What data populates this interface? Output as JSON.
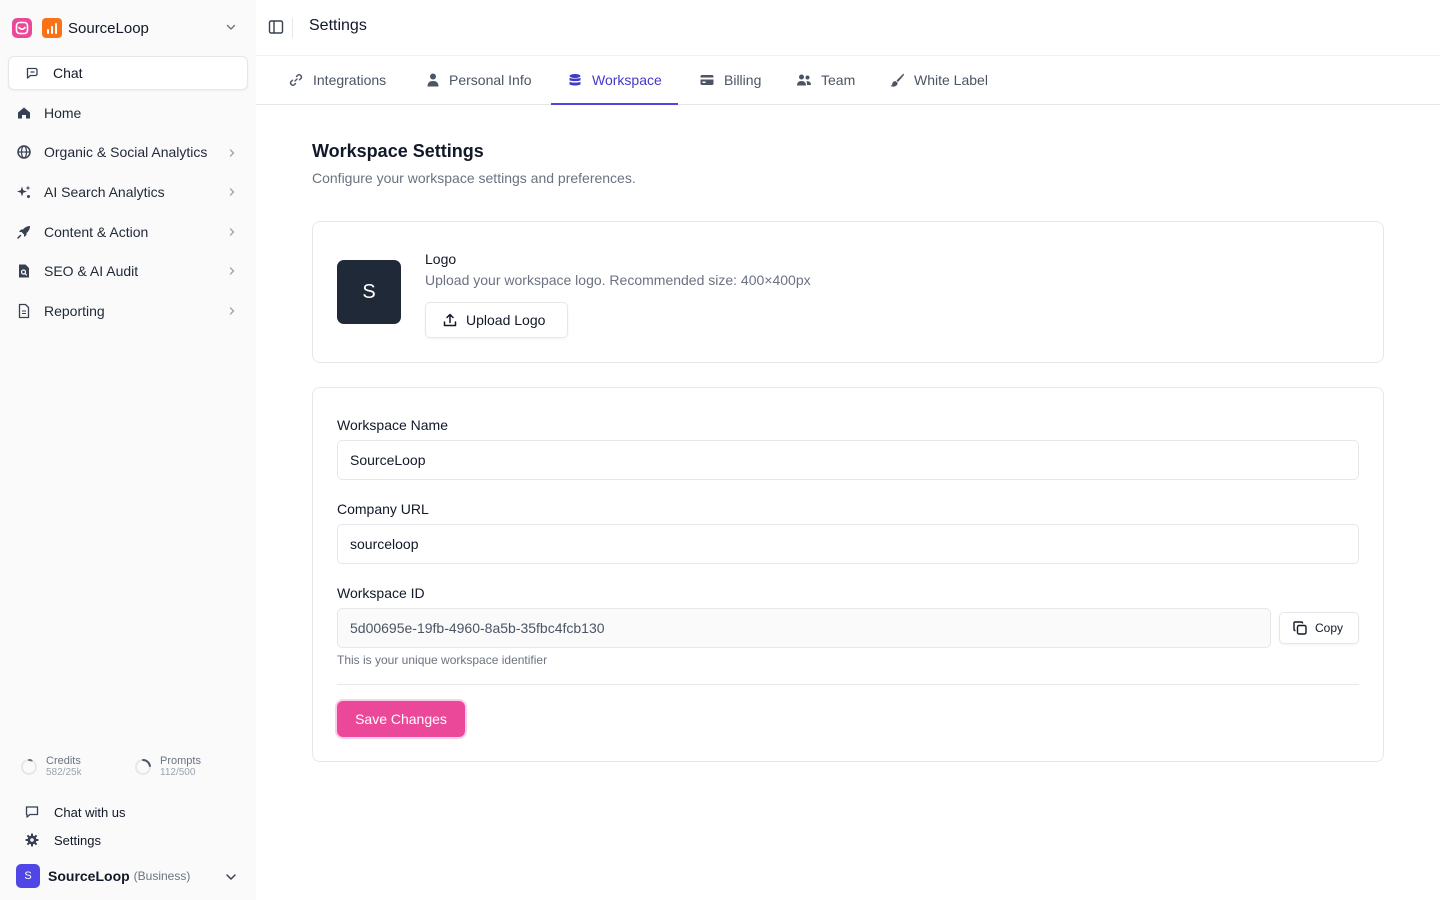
{
  "sidebar": {
    "workspace_name": "SourceLoop",
    "chat_label": "Chat",
    "items": [
      {
        "label": "Home"
      },
      {
        "label": "Organic & Social Analytics"
      },
      {
        "label": "AI Search Analytics"
      },
      {
        "label": "Content & Action"
      },
      {
        "label": "SEO & AI Audit"
      },
      {
        "label": "Reporting"
      }
    ],
    "usage": {
      "credits_label": "Credits",
      "credits_value": "582/25k",
      "prompts_label": "Prompts",
      "prompts_value": "112/500",
      "credits_fraction": 0.023,
      "prompts_fraction": 0.224
    },
    "chat_with_us": "Chat with us",
    "settings": "Settings",
    "account": {
      "avatar_letter": "S",
      "name": "SourceLoop",
      "plan": "(Business)"
    }
  },
  "header": {
    "title": "Settings"
  },
  "tabs": [
    {
      "label": "Integrations",
      "icon": "link-icon"
    },
    {
      "label": "Personal Info",
      "icon": "user-icon"
    },
    {
      "label": "Workspace",
      "icon": "database-icon",
      "active": true
    },
    {
      "label": "Billing",
      "icon": "credit-card-icon"
    },
    {
      "label": "Team",
      "icon": "users-icon"
    },
    {
      "label": "White Label",
      "icon": "brush-icon"
    }
  ],
  "workspace": {
    "title": "Workspace Settings",
    "subtitle": "Configure your workspace settings and preferences.",
    "logo": {
      "letter": "S",
      "title": "Logo",
      "description": "Upload your workspace logo. Recommended size: 400×400px",
      "upload_label": "Upload Logo"
    },
    "form": {
      "name_label": "Workspace Name",
      "name_value": "SourceLoop",
      "url_label": "Company URL",
      "url_value": "sourceloop",
      "id_label": "Workspace ID",
      "id_value": "5d00695e-19fb-4960-8a5b-35fbc4fcb130",
      "copy_label": "Copy",
      "id_hint": "This is your unique workspace identifier",
      "save_label": "Save Changes"
    }
  },
  "colors": {
    "accent": "#ec4899",
    "active_tab": "#4f46e5",
    "logo_tile": "#1f2937"
  }
}
